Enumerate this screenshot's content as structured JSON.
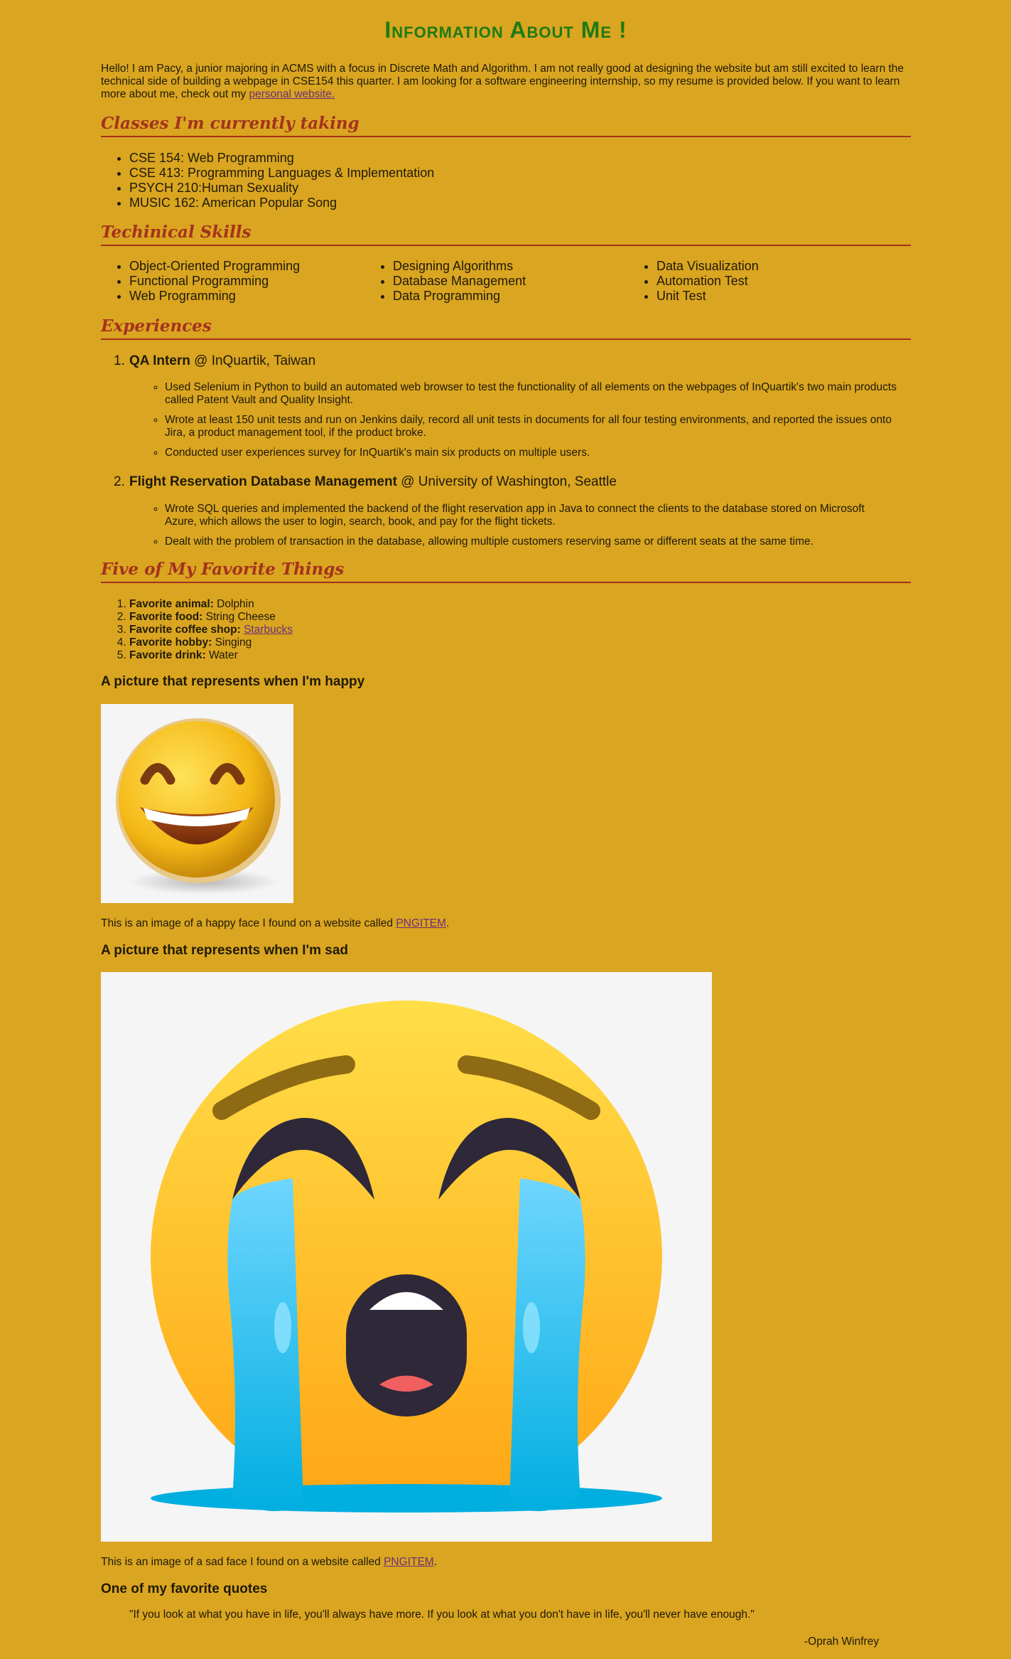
{
  "header": {
    "title": "Information About Me !"
  },
  "intro": {
    "text": "Hello! I am Pacy, a junior majoring in ACMS with a focus in Discrete Math and Algorithm. I am not really good at designing the website but am still excited to learn the technical side of building a webpage in CSE154 this quarter. I am looking for a software engineering internship, so my resume is provided below. If you want to learn more about me, check out my ",
    "link_text": "personal website."
  },
  "classes": {
    "heading": "Classes I'm currently taking",
    "items": [
      "CSE 154: Web Programming",
      "CSE 413: Programming Languages & Implementation",
      "PSYCH 210:Human Sexuality",
      "MUSIC 162: American Popular Song"
    ]
  },
  "skills": {
    "heading": "Techinical Skills",
    "col1": [
      "Object-Oriented Programming",
      "Functional Programming",
      "Web Programming"
    ],
    "col2": [
      "Designing Algorithms",
      "Database Management",
      "Data Programming"
    ],
    "col3": [
      "Data Visualization",
      "Automation Test",
      "Unit Test"
    ]
  },
  "experiences": {
    "heading": "Experiences",
    "items": [
      {
        "number": "1.",
        "role": "QA Intern",
        "org": " @ InQuartik, Taiwan",
        "bullets": [
          "Used Selenium in Python to build an automated web browser to test the functionality of all elements on the webpages of InQuartik's two main products called Patent Vault and Quality Insight.",
          "Wrote at least 150 unit tests and run on Jenkins daily, record all unit tests in documents for all four testing environments, and reported the issues onto Jira, a product management tool, if the product broke.",
          "Conducted user experiences survey for InQuartik's main six products on multiple users."
        ]
      },
      {
        "number": "2.",
        "role": "Flight Reservation Database Management",
        "org": " @ University of Washington, Seattle",
        "bullets": [
          "Wrote SQL queries and implemented the backend of the flight reservation app in Java to connect the clients to the database stored on Microsoft Azure, which allows the user to login, search, book, and pay for the flight tickets.",
          "Dealt with the problem of transaction in the database, allowing multiple customers reserving same or different seats at the same time."
        ]
      }
    ]
  },
  "favorites": {
    "heading": "Five of My Favorite Things",
    "items": [
      {
        "label": "Favorite animal:",
        "value": " Dolphin"
      },
      {
        "label": "Favorite food:",
        "value": " String Cheese"
      },
      {
        "label": "Favorite coffee shop:",
        "value": " ",
        "link": "Starbucks"
      },
      {
        "label": "Favorite hobby:",
        "value": " Singing"
      },
      {
        "label": "Favorite drink:",
        "value": " Water"
      }
    ]
  },
  "happy": {
    "heading": "A picture that represents when I'm happy",
    "caption_prefix": "This is an image of a happy face I found on a website called ",
    "caption_link": "PNGITEM",
    "caption_suffix": "."
  },
  "sad": {
    "heading": "A picture that represents when I'm sad",
    "caption_prefix": "This is an image of a sad face I found on a website called ",
    "caption_link": "PNGITEM",
    "caption_suffix": "."
  },
  "quote": {
    "heading": "One of my favorite quotes",
    "text": "\"If you look at what you have in life, you'll always have more. If you look at what you don't have in life, you'll never have enough.\"",
    "author": "-Oprah Winfrey"
  },
  "colors": {
    "background": "#daa520",
    "title": "#1f7a12",
    "section_heading": "#a4321e",
    "link": "#6b2f7a"
  }
}
